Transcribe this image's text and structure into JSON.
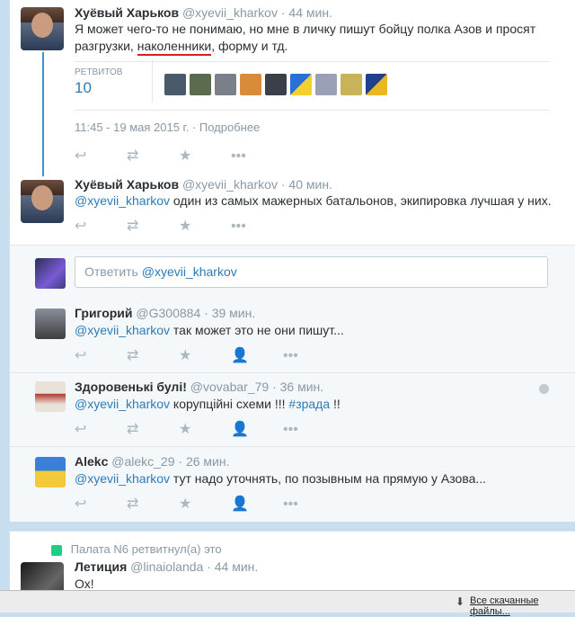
{
  "tweet_main": {
    "name": "Хуёвый Харьков",
    "handle": "@xyevii_kharkov",
    "time": "· 44 мин.",
    "text_line1": "Я может чего-то не понимаю, но мне в личку пишут бойцу полка Азов и просят",
    "text_line2_pre": "разгрузки, ",
    "text_line2_underlined": "наколенники",
    "text_line2_post": ", форму и тд.",
    "retweets_label": "РЕТВИТОВ",
    "retweets_count": "10",
    "timestamp": "11:45 - 19 мая 2015 г.",
    "details_link": "· Подробнее"
  },
  "tweet_reply1": {
    "name": "Хуёвый Харьков",
    "handle": "@xyevii_kharkov",
    "time": "· 40 мин.",
    "mention": "@xyevii_kharkov",
    "text": "один из самых мажерных батальонов, экипировка лучшая у них."
  },
  "reply_box": {
    "placeholder": "Ответить @xyevii_kharkov"
  },
  "replies": [
    {
      "name": "Григорий",
      "handle": "@G300884",
      "time": "· 39 мин.",
      "mention": "@xyevii_kharkov",
      "text": "так может это не они пишут..."
    },
    {
      "name": "Здоровенькі булі!",
      "handle": "@vovabar_79",
      "time": "· 36 мин.",
      "mention": "@xyevii_kharkov",
      "text": "корупційні схеми !!!",
      "hashtag": "#зрада",
      "tail": "!!"
    },
    {
      "name": "Alekc",
      "handle": "@alekc_29",
      "time": "· 26 мин.",
      "mention": "@xyevii_kharkov",
      "text": "тут надо уточнять, по позывным на прямую у Азова..."
    }
  ],
  "second_card": {
    "retweeted_by": "Палата N6 ретвитнул(а) это",
    "name": "Летиция",
    "handle": "@linaiolanda",
    "time": "· 44 мин.",
    "text": "Ох!"
  },
  "download_bar": {
    "label": "Все скачанные файлы..."
  },
  "colors": {
    "link": "#2b7bb9",
    "thread": "#3b94d9",
    "underline": "#d42121"
  }
}
